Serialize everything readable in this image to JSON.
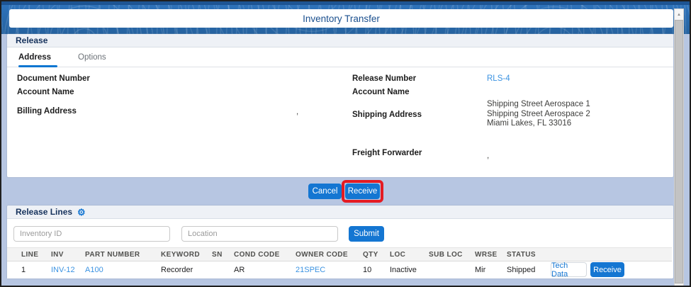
{
  "titlebar": {
    "title": "Inventory Transfer"
  },
  "release": {
    "header": "Release",
    "tabs": {
      "address": "Address",
      "options": "Options"
    },
    "fields": {
      "document_number_label": "Document Number",
      "account_name_left_label": "Account Name",
      "billing_address_label": "Billing Address",
      "billing_address_value": ",",
      "release_number_label": "Release Number",
      "release_number_value": "RLS-4",
      "account_name_right_label": "Account Name",
      "shipping_address_label": "Shipping Address",
      "shipping_address_lines": [
        "Shipping Street Aerospace 1",
        "Shipping Street Aerospace 2",
        "Miami Lakes, FL 33016"
      ],
      "freight_forwarder_label": "Freight Forwarder",
      "freight_forwarder_value": ","
    },
    "actions": {
      "cancel": "Cancel",
      "receive": "Receive"
    }
  },
  "lines": {
    "header": "Release Lines",
    "gear_icon": "settings-gear",
    "filters": {
      "inventory_placeholder": "Inventory ID",
      "location_placeholder": "Location",
      "submit": "Submit"
    },
    "table": {
      "headers": [
        "LINE",
        "INV",
        "PART NUMBER",
        "KEYWORD",
        "SN",
        "COND CODE",
        "OWNER CODE",
        "QTY",
        "LOC",
        "SUB LOC",
        "WRSE",
        "STATUS"
      ],
      "rows": [
        {
          "line": "1",
          "inv": "INV-12",
          "part_number": "A100",
          "keyword": "Recorder",
          "sn": "",
          "cond_code": "AR",
          "owner_code": "21SPEC",
          "qty": "10",
          "loc": "Inactive",
          "sub_loc": "",
          "wrse": "Mir",
          "status": "Shipped",
          "tech_data_button": "Tech Data",
          "receive_button": "Receive"
        }
      ]
    }
  },
  "colors": {
    "brand_blue": "#1476d2",
    "link_blue": "#3b93e2",
    "header_navy": "#16325c",
    "highlight_red": "#e41b23",
    "page_background": "#b7c6e2"
  }
}
